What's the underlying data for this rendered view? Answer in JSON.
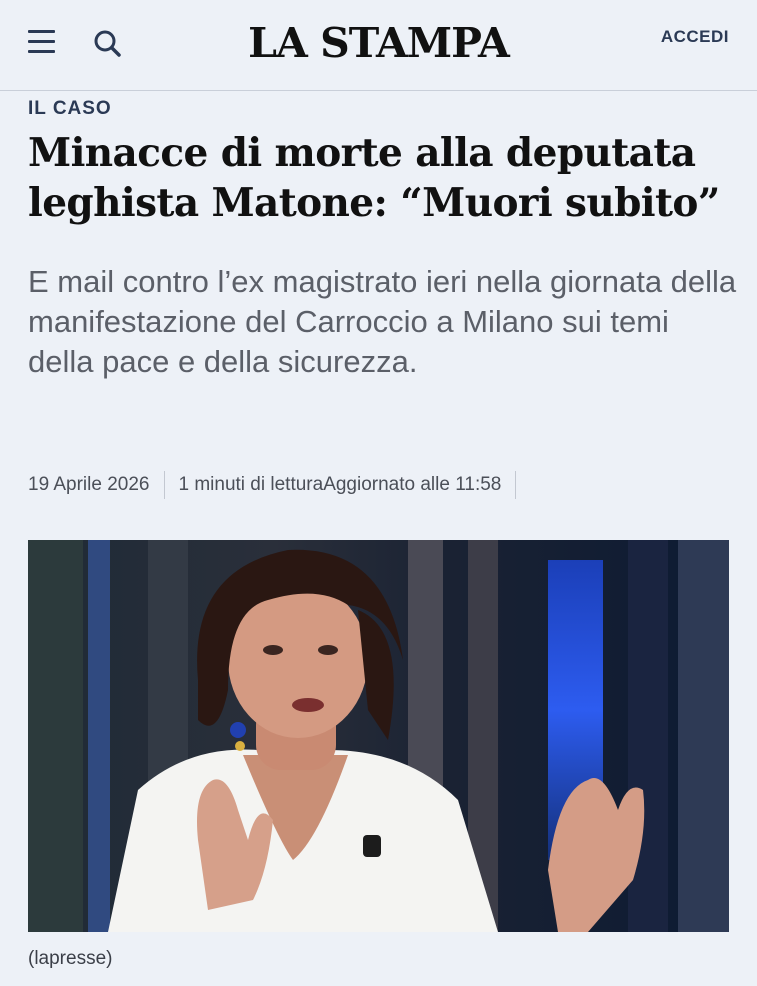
{
  "header": {
    "logo": "LA STAMPA",
    "login_label": "ACCEDI",
    "menu_icon": "hamburger-menu-icon",
    "search_icon": "search-icon"
  },
  "article": {
    "kicker": "IL CASO",
    "headline": "Minacce di morte alla deputata leghista Matone: “Muori subito”",
    "subtitle": "E mail contro l’ex magistrato ieri nella giornata della manifestazione del Carroccio a Milano sui temi della pace e della sicurezza.",
    "date": "19 Aprile 2026",
    "reading_time": "1 minuti di lettura",
    "updated": "Aggiornato alle 11:58",
    "photo_caption": "(lapresse)"
  },
  "colors": {
    "background": "#edf1f7",
    "accent": "#2b3a55",
    "headline": "#111111",
    "subtitle": "#5b5f68"
  }
}
